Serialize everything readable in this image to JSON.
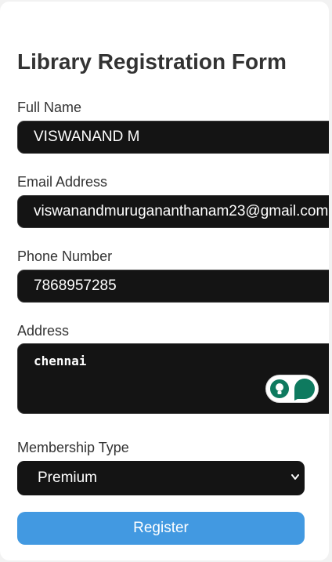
{
  "form": {
    "title": "Library Registration Form",
    "full_name": {
      "label": "Full Name",
      "value": "VISWANAND M"
    },
    "email": {
      "label": "Email Address",
      "value": "viswanandmurugananthanam23@gmail.com"
    },
    "phone": {
      "label": "Phone Number",
      "value": "7868957285"
    },
    "address": {
      "label": "Address",
      "value": "chennai"
    },
    "membership": {
      "label": "Membership Type",
      "selected": "Premium"
    },
    "submit_label": "Register"
  },
  "icons": {
    "extension_widget": [
      "lightbulb-icon",
      "speech-bubble-icon"
    ],
    "select_arrow": "chevron-down-icon"
  },
  "colors": {
    "input_background": "#141414",
    "button_accent": "#4299e1",
    "widget_green": "#0e7a5f"
  }
}
